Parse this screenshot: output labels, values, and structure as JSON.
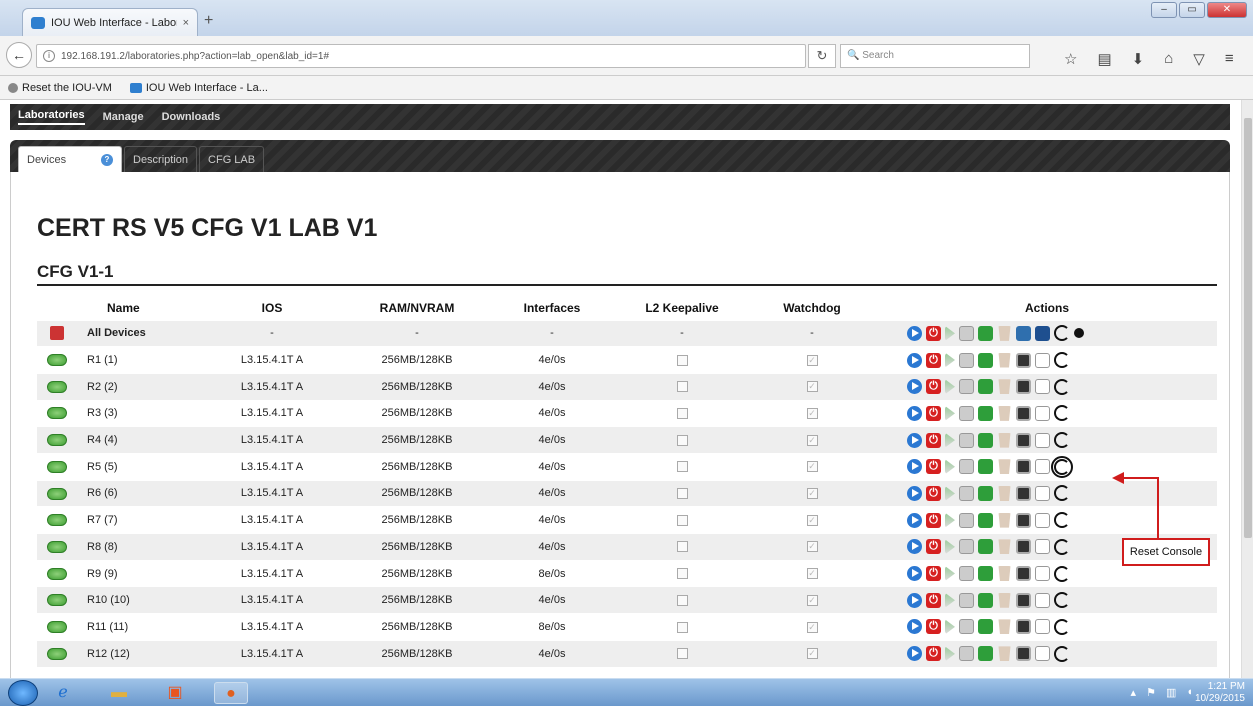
{
  "browser": {
    "tab_title": "IOU Web Interface - Labora...",
    "tab_close": "×",
    "new_tab": "+",
    "url": "192.168.191.2/laboratories.php?action=lab_open&lab_id=1#",
    "search_placeholder": "Search",
    "bookmarks": [
      {
        "label": "Reset the IOU-VM"
      },
      {
        "label": "IOU Web Interface - La..."
      }
    ]
  },
  "app": {
    "menu": [
      "Laboratories",
      "Manage",
      "Downloads"
    ],
    "tabs": [
      "Devices",
      "Description",
      "CFG LAB"
    ],
    "lab_title": "CERT RS V5 CFG V1 LAB V1",
    "section_title": "CFG V1-1"
  },
  "table": {
    "headers": [
      "Name",
      "IOS",
      "RAM/NVRAM",
      "Interfaces",
      "L2 Keepalive",
      "Watchdog",
      "Actions"
    ],
    "all_row": {
      "name": "All Devices",
      "ios": "-",
      "ram": "-",
      "interfaces": "-",
      "l2": "-",
      "watchdog": "-"
    },
    "rows": [
      {
        "name": "R1 (1)",
        "ios": "L3.15.4.1T A",
        "ram": "256MB/128KB",
        "interfaces": "4e/0s"
      },
      {
        "name": "R2 (2)",
        "ios": "L3.15.4.1T A",
        "ram": "256MB/128KB",
        "interfaces": "4e/0s"
      },
      {
        "name": "R3 (3)",
        "ios": "L3.15.4.1T A",
        "ram": "256MB/128KB",
        "interfaces": "4e/0s"
      },
      {
        "name": "R4 (4)",
        "ios": "L3.15.4.1T A",
        "ram": "256MB/128KB",
        "interfaces": "4e/0s"
      },
      {
        "name": "R5 (5)",
        "ios": "L3.15.4.1T A",
        "ram": "256MB/128KB",
        "interfaces": "4e/0s"
      },
      {
        "name": "R6 (6)",
        "ios": "L3.15.4.1T A",
        "ram": "256MB/128KB",
        "interfaces": "4e/0s"
      },
      {
        "name": "R7 (7)",
        "ios": "L3.15.4.1T A",
        "ram": "256MB/128KB",
        "interfaces": "4e/0s"
      },
      {
        "name": "R8 (8)",
        "ios": "L3.15.4.1T A",
        "ram": "256MB/128KB",
        "interfaces": "4e/0s"
      },
      {
        "name": "R9 (9)",
        "ios": "L3.15.4.1T A",
        "ram": "256MB/128KB",
        "interfaces": "8e/0s"
      },
      {
        "name": "R10 (10)",
        "ios": "L3.15.4.1T A",
        "ram": "256MB/128KB",
        "interfaces": "4e/0s"
      },
      {
        "name": "R11 (11)",
        "ios": "L3.15.4.1T A",
        "ram": "256MB/128KB",
        "interfaces": "8e/0s"
      },
      {
        "name": "R12 (12)",
        "ios": "L3.15.4.1T A",
        "ram": "256MB/128KB",
        "interfaces": "4e/0s"
      }
    ]
  },
  "callout": {
    "label": "Reset Console",
    "color": "#d01c1c"
  },
  "taskbar": {
    "time": "1:21 PM",
    "date": "10/29/2015"
  }
}
